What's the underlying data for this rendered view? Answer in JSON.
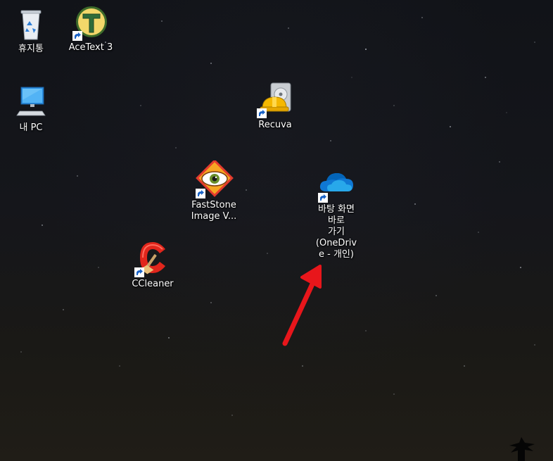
{
  "desktop": {
    "icons": [
      {
        "label": "휴지통",
        "icon": "recycle-bin-icon"
      },
      {
        "label": "AceText 3",
        "icon": "acetext-icon"
      },
      {
        "label": "내 PC",
        "icon": "computer-icon"
      },
      {
        "label": "Recuva",
        "icon": "recuva-icon"
      },
      {
        "label": "FastStone Image V...",
        "icon": "faststone-icon"
      },
      {
        "label_lines": [
          "바탕 화면",
          "바로",
          "가기(OneDriv",
          "e - 개인)"
        ],
        "icon": "onedrive-icon"
      },
      {
        "label": "CCleaner",
        "icon": "ccleaner-icon"
      }
    ],
    "annotation": {
      "icon": "red-arrow-icon",
      "color": "#e8161b"
    }
  },
  "colors": {
    "label_text": "#ffffff",
    "onedrive_blue": "#0f78d4",
    "ccleaner_red": "#e1261c"
  }
}
